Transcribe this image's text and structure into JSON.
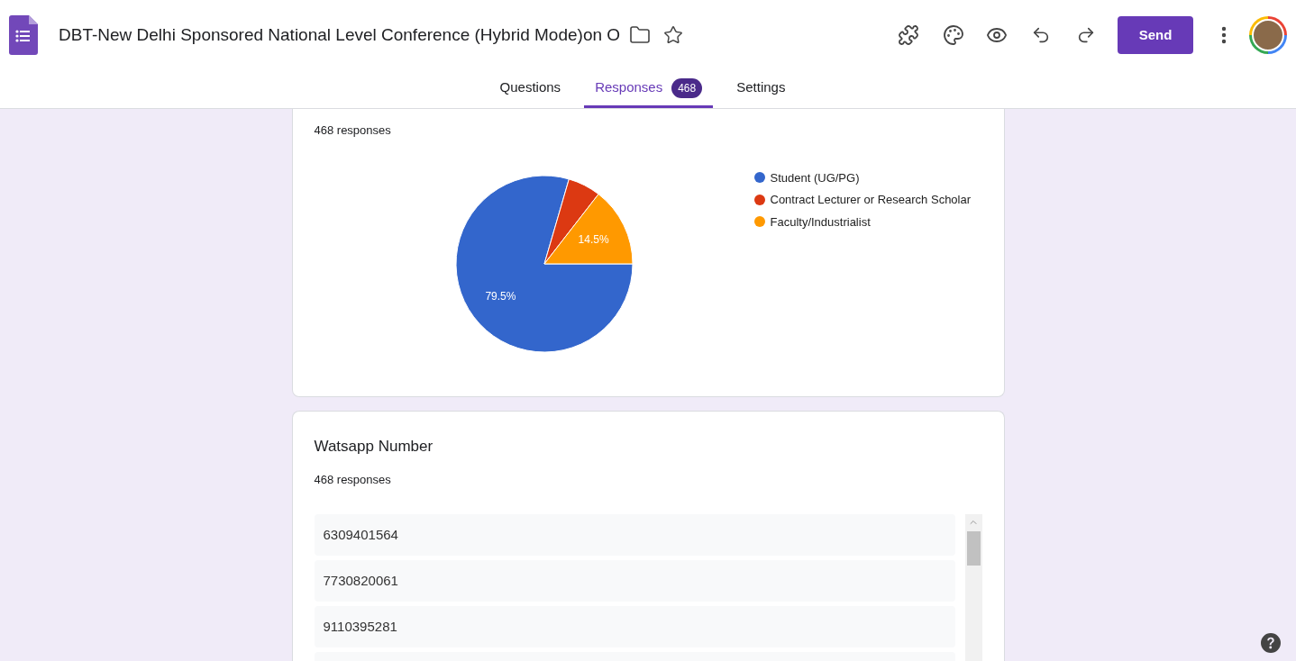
{
  "header": {
    "title": "DBT-New Delhi Sponsored National Level Conference (Hybrid Mode)on O",
    "send_button": "Send"
  },
  "tabs": [
    {
      "label": "Questions",
      "selected": false
    },
    {
      "label": "Responses",
      "selected": true,
      "badge": "468"
    },
    {
      "label": "Settings",
      "selected": false
    }
  ],
  "chart_card": {
    "response_count": "468 responses",
    "chart_data": {
      "type": "pie",
      "categories": [
        "Student (UG/PG)",
        "Contract Lecturer or Research Scholar",
        "Faculty/Industrialist"
      ],
      "values": [
        79.5,
        6.0,
        14.5
      ],
      "colors": [
        "#3366cc",
        "#dc3912",
        "#ff9900"
      ],
      "value_labels": [
        "79.5%",
        null,
        "14.5%"
      ]
    }
  },
  "text_card": {
    "question": "Watsapp Number",
    "response_count": "468 responses",
    "answers": [
      "6309401564",
      "7730820061",
      "9110395281"
    ]
  }
}
